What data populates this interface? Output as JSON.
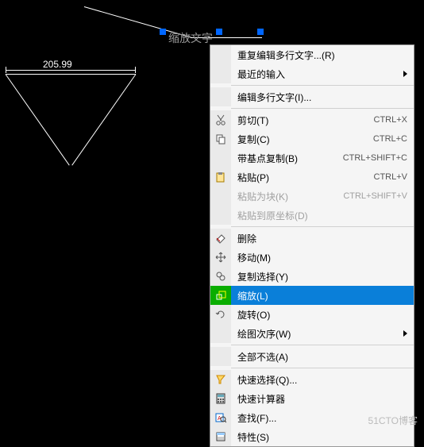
{
  "drawing": {
    "dimension_value": "205.99",
    "selected_text": "缩放文字"
  },
  "menu": {
    "repeat_edit": "重复编辑多行文字...(R)",
    "recent_input": "最近的输入",
    "edit_mtext": "编辑多行文字(I)...",
    "cut": {
      "label": "剪切(T)",
      "shortcut": "CTRL+X"
    },
    "copy": {
      "label": "复制(C)",
      "shortcut": "CTRL+C"
    },
    "copy_base": {
      "label": "带基点复制(B)",
      "shortcut": "CTRL+SHIFT+C"
    },
    "paste": {
      "label": "粘贴(P)",
      "shortcut": "CTRL+V"
    },
    "paste_block": {
      "label": "粘贴为块(K)",
      "shortcut": "CTRL+SHIFT+V"
    },
    "paste_orig": "粘贴到原坐标(D)",
    "delete": "删除",
    "move": "移动(M)",
    "copy_selection": "复制选择(Y)",
    "scale": "缩放(L)",
    "rotate": "旋转(O)",
    "draw_order": "绘图次序(W)",
    "deselect_all": "全部不选(A)",
    "quick_select": "快速选择(Q)...",
    "quickcalc": "快速计算器",
    "find": "查找(F)...",
    "properties": "特性(S)"
  },
  "watermark": "51CTO博客",
  "icons": {
    "cut": "cut",
    "copy": "copy",
    "paste": "paste",
    "delete": "eraser",
    "move": "move",
    "copy_selection": "copysel",
    "scale": "scale",
    "rotate": "rotate",
    "quick_select": "qselect",
    "quickcalc": "calc",
    "find": "find",
    "properties": "props"
  }
}
